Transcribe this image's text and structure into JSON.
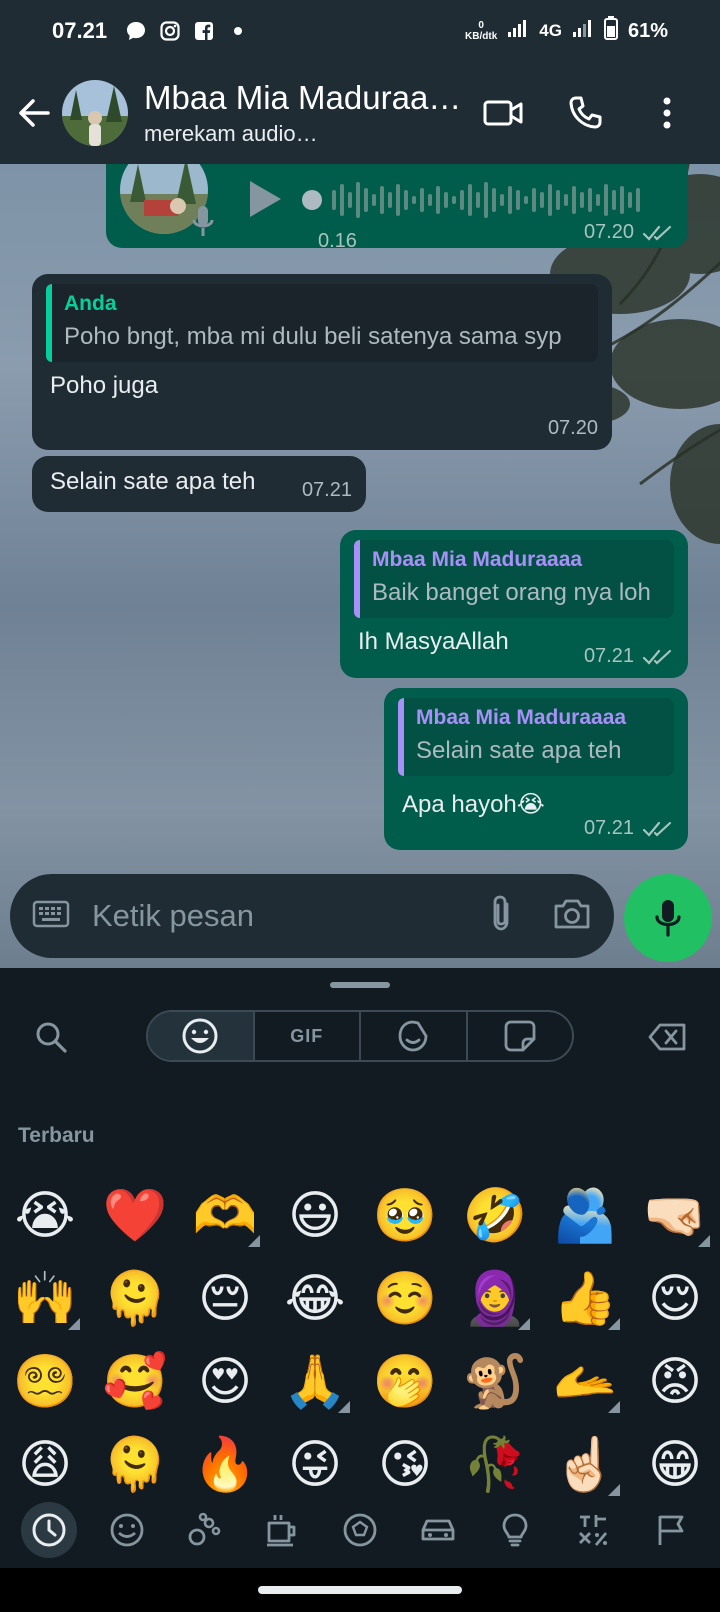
{
  "status_bar": {
    "time": "07.21",
    "net_speed_value": "0",
    "net_speed_unit": "KB/dtk",
    "network": "4G",
    "battery": "61%"
  },
  "header": {
    "contact_name": "Mbaa Mia Maduraa…",
    "status": "merekam audio…"
  },
  "messages": {
    "voice": {
      "duration": "0.16",
      "time": "07.20"
    },
    "msg1": {
      "quote_author": "Anda",
      "quote_text": "Poho bngt, mba mi dulu beli satenya sama syp",
      "text": "Poho juga",
      "time": "07.20"
    },
    "msg2": {
      "text": "Selain sate apa teh",
      "time": "07.21"
    },
    "msg3": {
      "quote_author": "Mbaa Mia Maduraaaa",
      "quote_text": "Baik banget orang nya loh",
      "text": "Ih MasyaAllah",
      "time": "07.21"
    },
    "msg4": {
      "quote_author": "Mbaa Mia Maduraaaa",
      "quote_text": "Selain sate apa teh",
      "text": "Apa hayoh😭",
      "time": "07.21"
    }
  },
  "composer": {
    "placeholder": "Ketik pesan"
  },
  "emoji_panel": {
    "gif_tab": "GIF",
    "section_title": "Terbaru",
    "emojis": [
      "😭",
      "❤️",
      "🫶",
      "😃",
      "🥹",
      "🤣",
      "🫂",
      "🤜🏻",
      "🙌",
      "🫠",
      "😔",
      "😂",
      "☺️",
      "🧕",
      "👍",
      "😌",
      "😵‍💫",
      "🥰",
      "😍",
      "🙏",
      "🤭",
      "🐒",
      "🫴",
      "😡",
      "😩",
      "🫠",
      "🔥",
      "😜",
      "😘",
      "🥀",
      "☝🏻",
      "😁"
    ],
    "variant_indices": [
      2,
      7,
      8,
      13,
      14,
      19,
      22,
      30
    ]
  },
  "colors": {
    "header_bg": "#1f2c34",
    "outgoing_bubble": "#005c4b",
    "incoming_bubble": "#202c33",
    "mic_button": "#21c063",
    "panel_bg": "#121b22"
  }
}
